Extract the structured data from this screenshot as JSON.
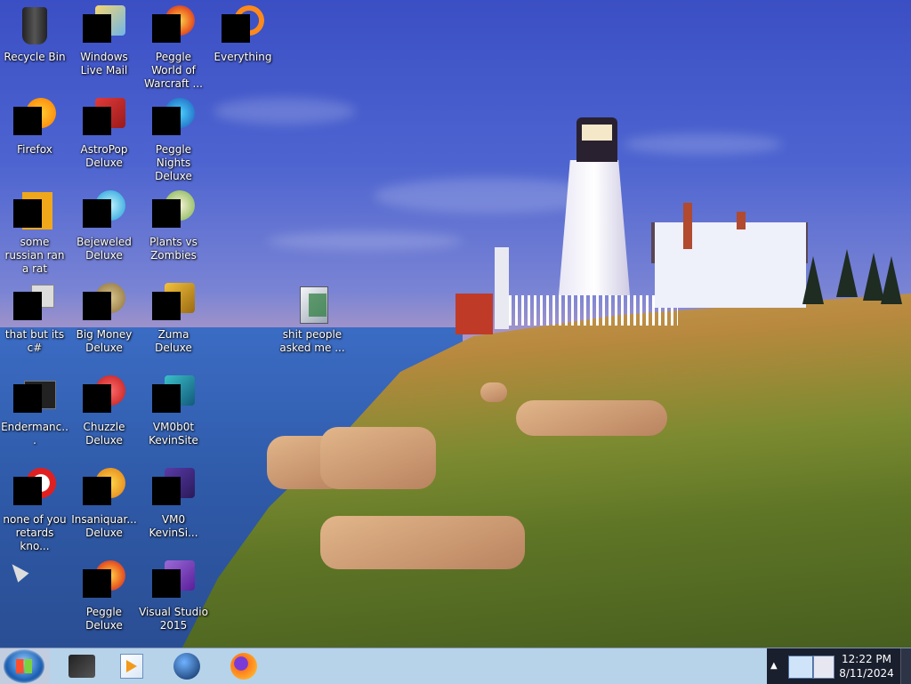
{
  "desktop": {
    "icons": [
      {
        "label": "Recycle Bin",
        "icon": "recycle-bin-icon"
      },
      {
        "label": "Windows Live Mail",
        "icon": "mail-icon"
      },
      {
        "label": "Peggle World of Warcraft ...",
        "icon": "game-icon"
      },
      {
        "label": "Everything",
        "icon": "search-icon"
      },
      {
        "label": "Firefox",
        "icon": "firefox-icon"
      },
      {
        "label": "AstroPop Deluxe",
        "icon": "game-icon"
      },
      {
        "label": "Peggle Nights Deluxe",
        "icon": "game-icon"
      },
      {
        "label": "some russian ran a rat",
        "icon": "file-icon"
      },
      {
        "label": "Bejeweled Deluxe",
        "icon": "gem-icon"
      },
      {
        "label": "Plants vs Zombies",
        "icon": "plant-icon"
      },
      {
        "label": "that but its c#",
        "icon": "file-icon"
      },
      {
        "label": "Big Money Deluxe",
        "icon": "money-bag-icon"
      },
      {
        "label": "Zuma Deluxe",
        "icon": "game-icon"
      },
      {
        "label": "shit people asked me ...",
        "icon": "folder-icon"
      },
      {
        "label": "Endermanc...",
        "icon": "terminal-icon"
      },
      {
        "label": "Chuzzle Deluxe",
        "icon": "game-icon"
      },
      {
        "label": "VM0b0t KevinSite",
        "icon": "application-icon"
      },
      {
        "label": "none of you retards kno...",
        "icon": "document-icon"
      },
      {
        "label": "Insaniquar... Deluxe",
        "icon": "fish-icon"
      },
      {
        "label": "VM0 KevinSi...",
        "icon": "application-icon"
      },
      {
        "label": "Peggle Deluxe",
        "icon": "game-icon"
      },
      {
        "label": "Visual Studio 2015",
        "icon": "visual-studio-icon"
      }
    ]
  },
  "taskbar": {
    "start_label": "Start",
    "pinned": [
      {
        "name": "file-explorer",
        "icon": "folder-icon"
      },
      {
        "name": "media-player",
        "icon": "media-player-icon"
      },
      {
        "name": "network",
        "icon": "globe-icon"
      },
      {
        "name": "firefox",
        "icon": "firefox-icon"
      }
    ],
    "clock": {
      "time": "12:22 PM",
      "date": "8/11/2024"
    }
  }
}
